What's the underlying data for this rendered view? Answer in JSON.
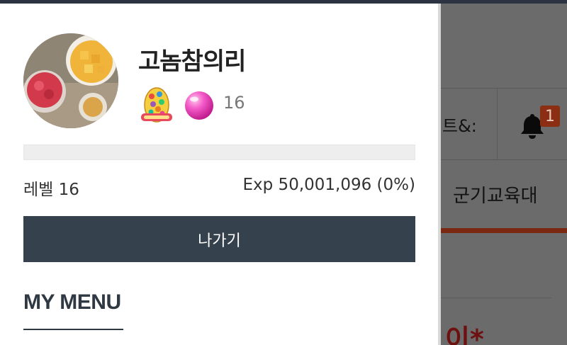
{
  "profile": {
    "username": "고놈참의리",
    "avatar_icon": "food-bowls-avatar",
    "badge_icon": "rainbow-egg-icon",
    "gem_icon": "pink-gem-icon",
    "gem_count": "16"
  },
  "experience": {
    "level_label": "레벨 16",
    "exp_label": "Exp 50,001,096 (0%)",
    "progress_fraction": 0.0
  },
  "actions": {
    "logout_label": "나가기"
  },
  "menu": {
    "heading": "MY MENU"
  },
  "background": {
    "nav_item_text": "트&:",
    "notification_count": "1",
    "category_text": "군기교육대",
    "title_fragment": "이*"
  },
  "colors": {
    "drawer_bg": "#ffffff",
    "button_bg": "#36414e",
    "heading_color": "#2f3943",
    "accent_red": "#7a2812"
  }
}
